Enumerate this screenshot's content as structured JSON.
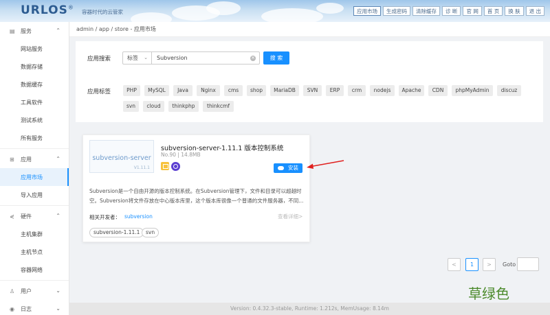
{
  "header": {
    "logo": "URLOS",
    "logo_reg": "®",
    "slogan": "容器时代的云管家",
    "nav": [
      "应用市场",
      "生成密码",
      "清除缓存",
      "诊 断",
      "官 网",
      "首 页",
      "换 肤",
      "退 出"
    ]
  },
  "sidebar": {
    "services": {
      "title": "服务",
      "items": [
        "网站服务",
        "数据存储",
        "数据缓存",
        "工具软件",
        "测试系统",
        "所有服务"
      ]
    },
    "apps": {
      "title": "应用",
      "items": [
        "应用市场",
        "导入应用"
      ]
    },
    "hardware": {
      "title": "硬件",
      "items": [
        "主机集群",
        "主机节点",
        "容器网络"
      ]
    },
    "users": {
      "title": "用户"
    },
    "logs": {
      "title": "日志"
    }
  },
  "breadcrumb": "admin / app / store - 应用市场",
  "search": {
    "label": "应用搜索",
    "select_value": "标签",
    "input_value": "Subversion",
    "button": "搜 索"
  },
  "tags": {
    "label": "应用标签",
    "row1": [
      "PHP",
      "MySQL",
      "Java",
      "Nginx",
      "cms",
      "shop",
      "MariaDB",
      "SVN",
      "ERP",
      "crm",
      "nodejs",
      "Apache",
      "CDN",
      "phpMyAdmin",
      "discuz"
    ],
    "row2": [
      "svn",
      "cloud",
      "thinkphp",
      "thinkcmf"
    ]
  },
  "app": {
    "thumb_name": "subversion-server",
    "thumb_version": "V1.11.1",
    "title": "subversion-server-1.11.1 版本控制系统",
    "meta": "No.90  |  14.8MB",
    "install": "安装",
    "desc_line1": "Subversion是一个自由开源的版本控制系统。在Subversion管理下，文件和目录可以超越时",
    "desc_line2": "空。Subversion将文件存放在中心版本库里，这个版本库很像一个普通的文件服务器，不同...",
    "dev_label": "相关开发者：",
    "dev_name": "subversion",
    "more": "查看详细>",
    "chips": [
      "subversion-1.11.1",
      "svn"
    ]
  },
  "pagination": {
    "prev": "<",
    "current": "1",
    "next": ">",
    "goto": "Goto"
  },
  "footer": "Version: 0.4.32.3-stable,   Runtime: 1.212s,   MemUsage: 8.14m",
  "watermark": "草绿色",
  "colors": {
    "primary": "#1890ff",
    "watermark": "#4b8a2b",
    "header_logo": "#2d5c91"
  }
}
